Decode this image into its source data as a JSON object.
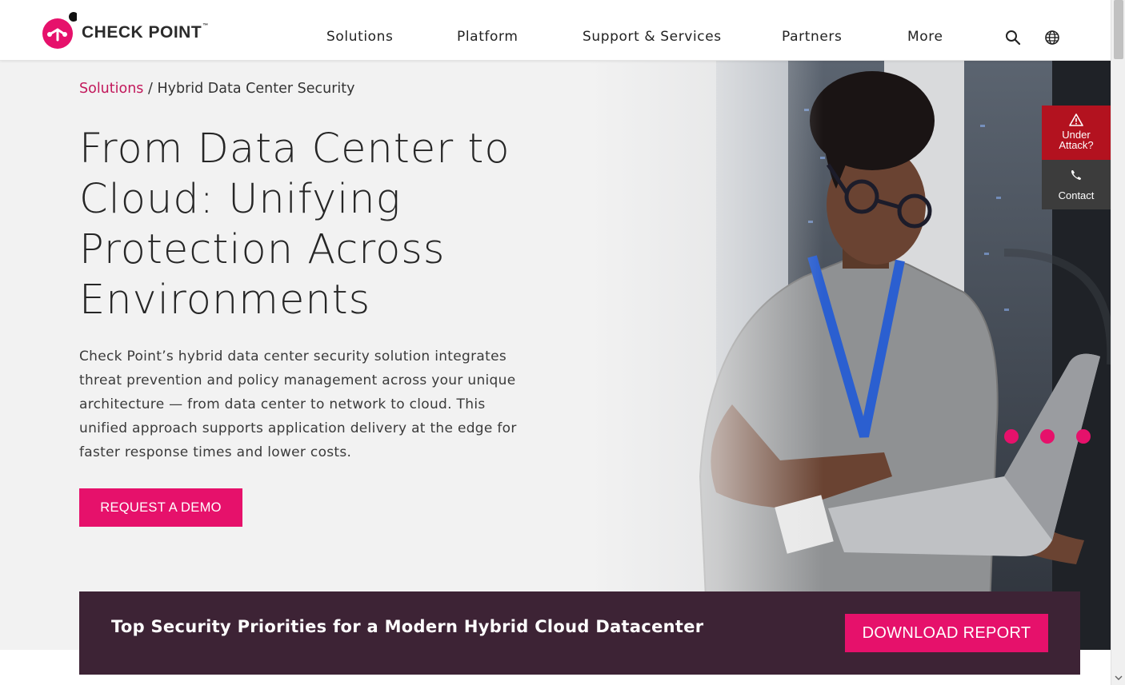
{
  "brand": {
    "name": "CHECK POINT",
    "trademark": "™",
    "primary_color": "#e6116b",
    "dark_color": "#3d2335",
    "alert_color": "#b3121f"
  },
  "nav": {
    "items": [
      "Solutions",
      "Platform",
      "Support & Services",
      "Partners",
      "More"
    ],
    "icons": [
      "search-icon",
      "globe-icon"
    ]
  },
  "breadcrumb": {
    "parent": "Solutions",
    "separator": " / ",
    "current": "Hybrid Data Center Security"
  },
  "hero": {
    "title": "From Data Center to Cloud: Unifying Protection Across Environments",
    "description": "Check Point’s hybrid data center security solution integrates threat prevention and policy management across your unique architecture — from data center to network to cloud. This unified approach supports application delivery at the edge for faster response times and lower costs.",
    "cta": "REQUEST A DEMO"
  },
  "widget": {
    "attack_line1": "Under",
    "attack_line2": "Attack?",
    "contact": "Contact"
  },
  "promo": {
    "text": "Top Security Priorities for a Modern Hybrid Cloud Datacenter",
    "cta": "DOWNLOAD REPORT"
  }
}
